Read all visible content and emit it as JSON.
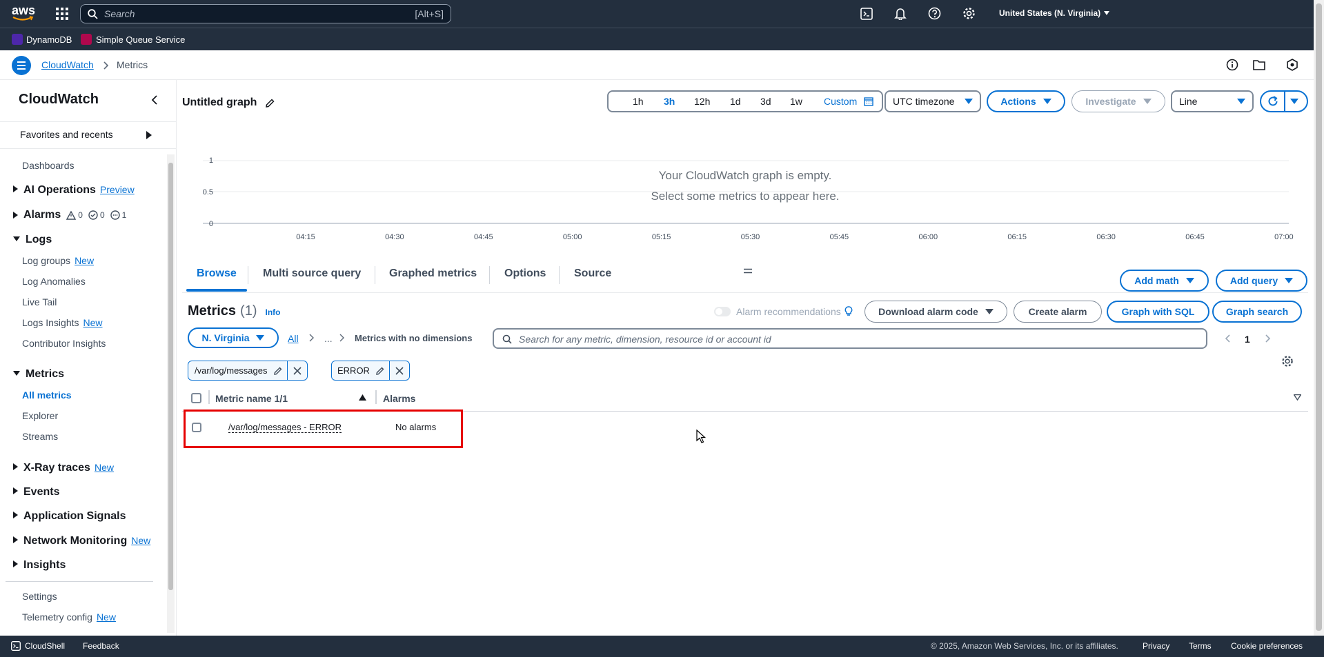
{
  "topnav": {
    "logo": "aws",
    "search_placeholder": "Search",
    "search_shortcut": "[Alt+S]",
    "region": "United States (N. Virginia)"
  },
  "favorites": [
    {
      "label": "DynamoDB",
      "color": "#4d27aa"
    },
    {
      "label": "Simple Queue Service",
      "color": "#b0084d"
    }
  ],
  "breadcrumb": {
    "service": "CloudWatch",
    "page": "Metrics"
  },
  "sidebar": {
    "title": "CloudWatch",
    "favorites": "Favorites and recents",
    "dashboards": "Dashboards",
    "ai_ops": "AI Operations",
    "ai_ops_badge": "Preview",
    "alarms": "Alarms",
    "alarm_counts": [
      "0",
      "0",
      "1"
    ],
    "logs": "Logs",
    "log_items": [
      {
        "label": "Log groups",
        "badge": "New"
      },
      {
        "label": "Log Anomalies",
        "badge": ""
      },
      {
        "label": "Live Tail",
        "badge": ""
      },
      {
        "label": "Logs Insights",
        "badge": "New"
      },
      {
        "label": "Contributor Insights",
        "badge": ""
      }
    ],
    "metrics": "Metrics",
    "metric_items": [
      "All metrics",
      "Explorer",
      "Streams"
    ],
    "xray": "X-Ray traces",
    "xray_badge": "New",
    "events": "Events",
    "app_signals": "Application Signals",
    "network": "Network Monitoring",
    "network_badge": "New",
    "insights": "Insights",
    "settings": "Settings",
    "telemetry": "Telemetry config",
    "telemetry_badge": "New"
  },
  "graph": {
    "title": "Untitled graph",
    "ranges": [
      "1h",
      "3h",
      "12h",
      "1d",
      "3d",
      "1w",
      "Custom"
    ],
    "active_range": "3h",
    "timezone": "UTC timezone",
    "actions": "Actions",
    "investigate": "Investigate",
    "chart_type": "Line",
    "empty_line1": "Your CloudWatch graph is empty.",
    "empty_line2": "Select some metrics to appear here.",
    "y_ticks": [
      "1",
      "0.5",
      "0"
    ],
    "x_ticks": [
      "04:15",
      "04:30",
      "04:45",
      "05:00",
      "05:15",
      "05:30",
      "05:45",
      "06:00",
      "06:15",
      "06:30",
      "06:45",
      "07:00"
    ]
  },
  "tabs": [
    "Browse",
    "Multi source query",
    "Graphed metrics",
    "Options",
    "Source"
  ],
  "tab_buttons": {
    "add_math": "Add math",
    "add_query": "Add query"
  },
  "metrics_panel": {
    "title": "Metrics",
    "count": "(1)",
    "info": "Info",
    "alarm_rec": "Alarm recommendations",
    "download": "Download alarm code",
    "create_alarm": "Create alarm",
    "graph_sql": "Graph with SQL",
    "graph_search": "Graph search",
    "region": "N. Virginia",
    "crumb_all": "All",
    "crumb_ellipsis": "...",
    "crumb_current": "Metrics with no dimensions",
    "search_placeholder": "Search for any metric, dimension, resource id or account id",
    "page": "1",
    "tokens": [
      "/var/log/messages",
      "ERROR"
    ],
    "col_metric": "Metric name 1/1",
    "col_alarms": "Alarms",
    "rows": [
      {
        "metric": "/var/log/messages - ERROR",
        "alarms": "No alarms"
      }
    ]
  },
  "footer": {
    "cloudshell": "CloudShell",
    "feedback": "Feedback",
    "copyright": "© 2025, Amazon Web Services, Inc. or its affiliates.",
    "privacy": "Privacy",
    "terms": "Terms",
    "cookies": "Cookie preferences"
  }
}
